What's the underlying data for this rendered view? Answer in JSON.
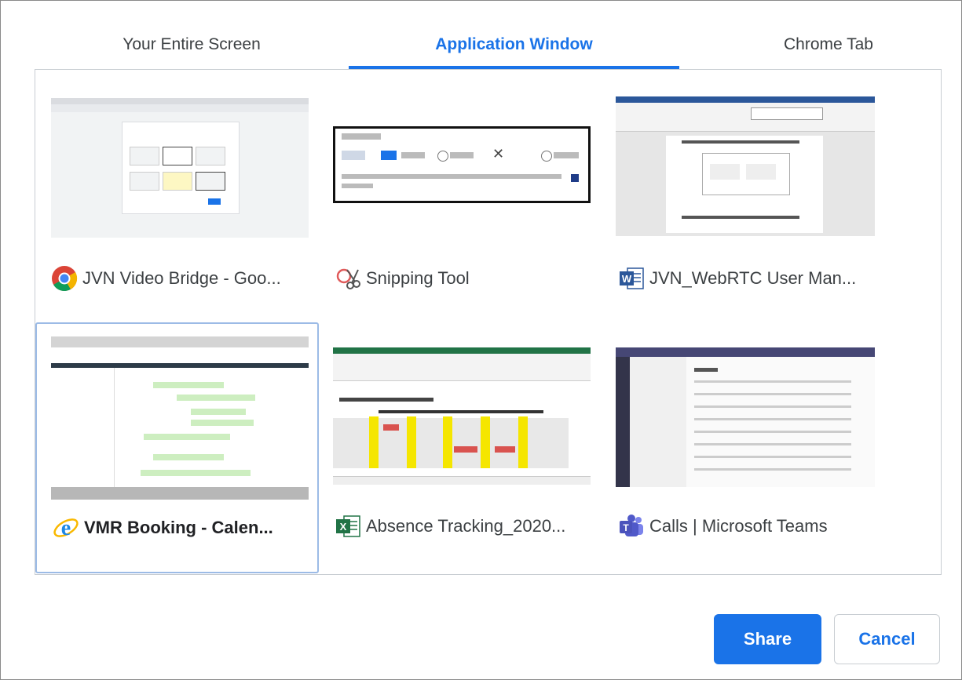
{
  "tabs": [
    {
      "label": "Your Entire Screen"
    },
    {
      "label": "Application Window"
    },
    {
      "label": "Chrome Tab"
    }
  ],
  "windows": [
    {
      "title": "JVN Video Bridge - Goo...",
      "icon": "chrome-icon",
      "thumb_text": ""
    },
    {
      "title": "Snipping Tool",
      "icon": "snipping-tool-icon"
    },
    {
      "title": "JVN_WebRTC User Man...",
      "icon": "word-icon"
    },
    {
      "title": "VMR Booking - Calen...",
      "icon": "internet-explorer-icon",
      "selected": true
    },
    {
      "title": "Absence Tracking_2020...",
      "icon": "excel-icon"
    },
    {
      "title": "Calls | Microsoft Teams",
      "icon": "teams-icon"
    }
  ],
  "buttons": {
    "share": "Share",
    "cancel": "Cancel"
  },
  "colors": {
    "accent": "#1a73e8",
    "selected_border": "#9cbbe6"
  }
}
